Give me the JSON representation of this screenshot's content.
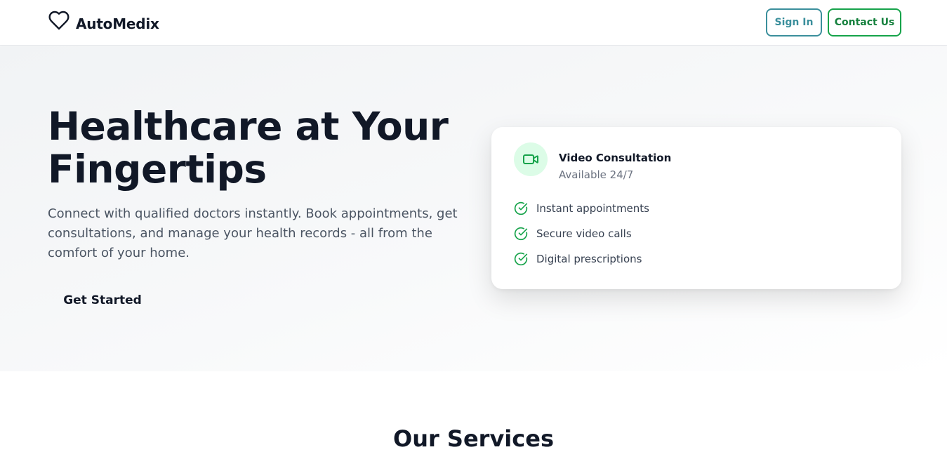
{
  "header": {
    "brand": "AutoMedix",
    "logo_icon": "heart-icon",
    "sign_in_label": "Sign In",
    "contact_label": "Contact Us"
  },
  "hero": {
    "title": "Healthcare at Your Fingertips",
    "subtitle": "Connect with qualified doctors instantly. Book appointments, get consultations, and manage your health records - all from the comfort of your home.",
    "cta_label": "Get Started"
  },
  "card": {
    "icon": "video-camera-icon",
    "title": "Video Consultation",
    "subtitle": "Available 24/7",
    "features": [
      {
        "label": "Instant appointments",
        "icon": "check-circle-icon"
      },
      {
        "label": "Secure video calls",
        "icon": "check-circle-icon"
      },
      {
        "label": "Digital prescriptions",
        "icon": "check-circle-icon"
      }
    ]
  },
  "services": {
    "title": "Our Services"
  },
  "colors": {
    "accent_green": "#16a34a",
    "accent_teal": "#3b8f9c",
    "icon_bg": "#dcfce7",
    "text_dark": "#111827"
  }
}
